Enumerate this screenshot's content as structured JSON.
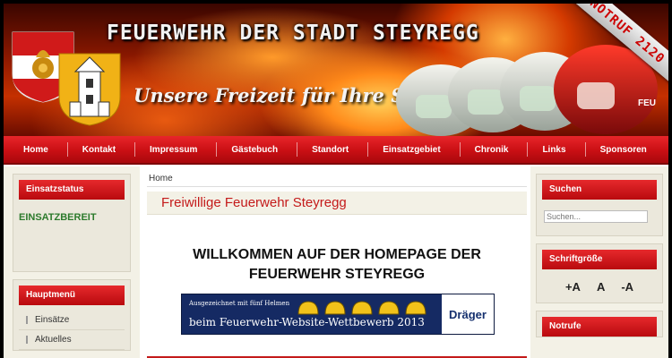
{
  "header": {
    "title": "FEUERWEHR DER STADT STEYREGG",
    "slogan": "Unsere Freizeit für Ihre Sicherheit",
    "ribbon": "NOTRUF 2120"
  },
  "nav": {
    "items": [
      "Home",
      "Kontakt",
      "Impressum",
      "Gästebuch",
      "Standort",
      "Einsatzgebiet",
      "Chronik",
      "Links",
      "Sponsoren"
    ]
  },
  "left": {
    "status_title": "Einsatzstatus",
    "status_value": "EINSATZBEREIT",
    "menu_title": "Hauptmenü",
    "menu_items": [
      "Einsätze",
      "Aktuelles"
    ]
  },
  "main": {
    "breadcrumb": "Home",
    "heading": "Freiwillige Feuerwehr Steyregg",
    "welcome_line1": "WILLKOMMEN AUF DER HOMEPAGE DER",
    "welcome_line2": "FEUERWEHR STEYREGG",
    "banner_top": "Ausgezeichnet mit fünf Helmen",
    "banner_bottom": "beim Feuerwehr-Website-Wettbewerb 2013",
    "banner_brand": "Dräger"
  },
  "right": {
    "search_title": "Suchen",
    "search_placeholder": "Suchen...",
    "fontsize_title": "Schriftgröße",
    "fontsize_buttons": [
      "+A",
      "A",
      "-A"
    ],
    "notruf_title": "Notrufe"
  },
  "colors": {
    "accent_red": "#c90f14",
    "status_green": "#2c7a2c",
    "heading_red": "#c41a1a"
  }
}
